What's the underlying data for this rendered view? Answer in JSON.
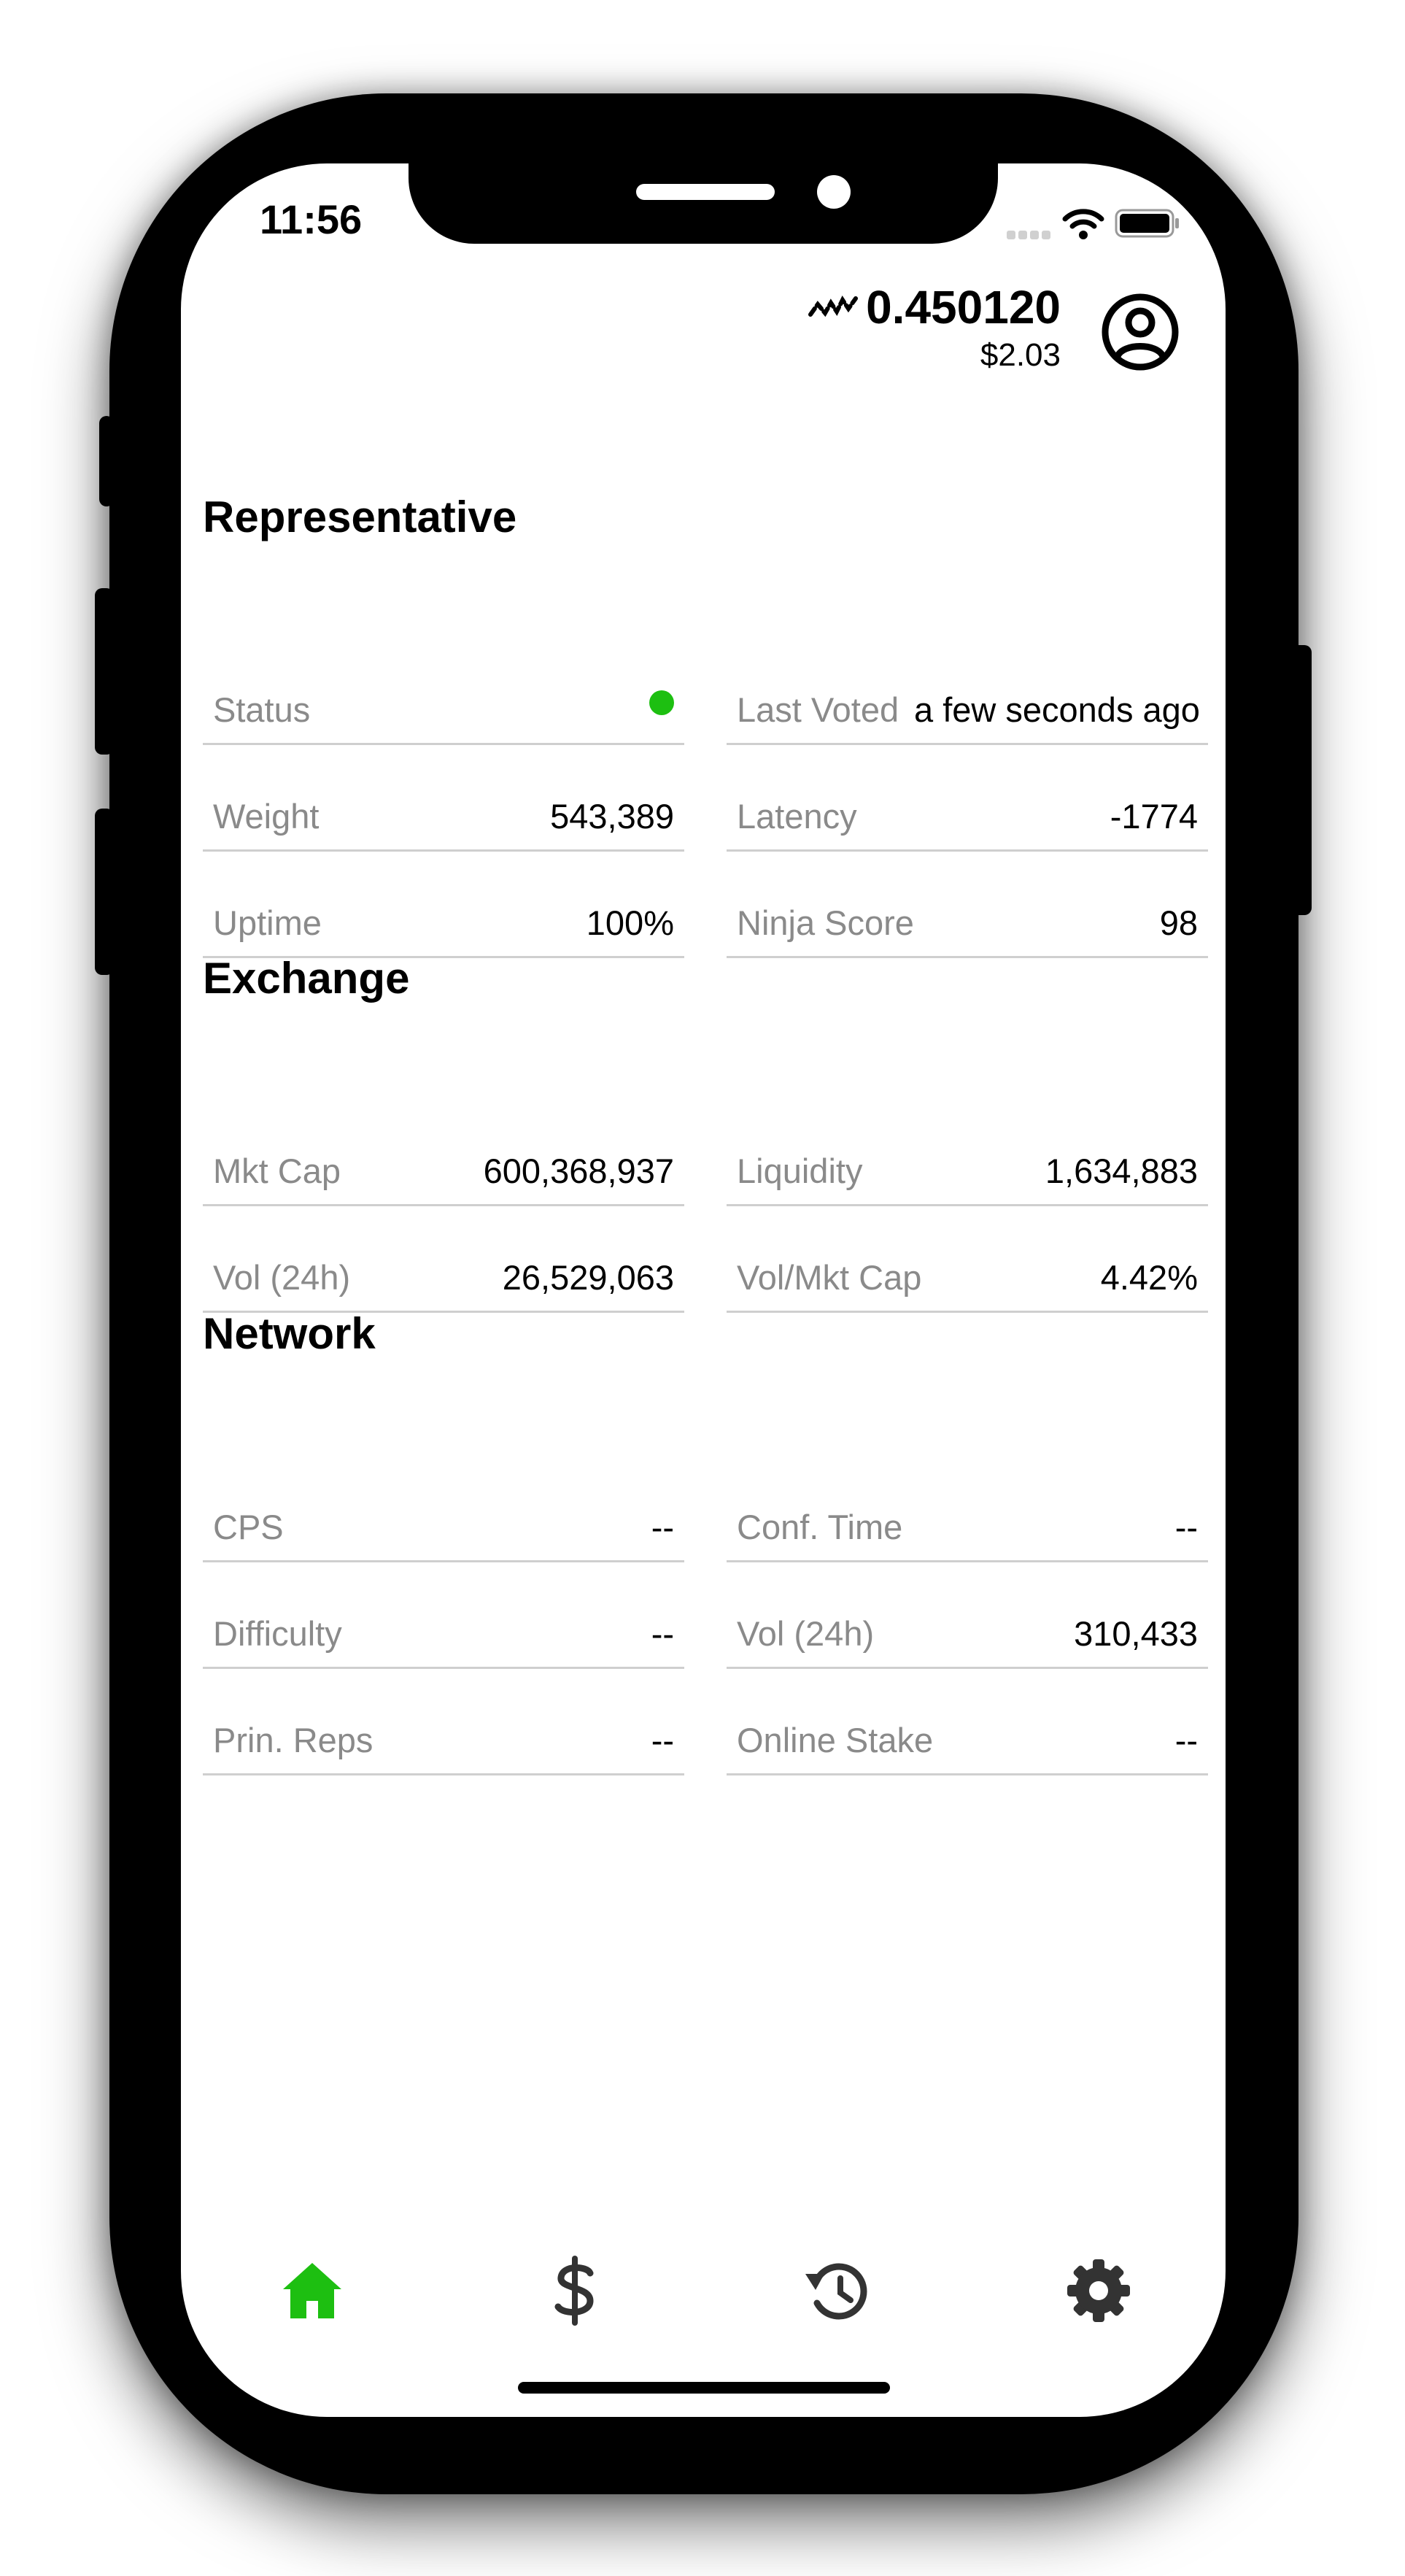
{
  "status_bar": {
    "time": "11:56"
  },
  "header": {
    "balance": "0.450120",
    "fiat": "$2.03"
  },
  "representative": {
    "title": "Representative",
    "status_label": "Status",
    "status_color": "#1dbf11",
    "last_voted_label": "Last Voted",
    "last_voted_value": "a few seconds ago",
    "weight_label": "Weight",
    "weight_value": "543,389",
    "latency_label": "Latency",
    "latency_value": "-1774",
    "uptime_label": "Uptime",
    "uptime_value": "100%",
    "ninja_label": "Ninja Score",
    "ninja_value": "98"
  },
  "exchange": {
    "title": "Exchange",
    "mktcap_label": "Mkt Cap",
    "mktcap_value": "600,368,937",
    "liquidity_label": "Liquidity",
    "liquidity_value": "1,634,883",
    "vol_label": "Vol (24h)",
    "vol_value": "26,529,063",
    "volmkt_label": "Vol/Mkt Cap",
    "volmkt_value": "4.42%"
  },
  "network": {
    "title": "Network",
    "cps_label": "CPS",
    "cps_value": "--",
    "conf_label": "Conf. Time",
    "conf_value": "--",
    "difficulty_label": "Difficulty",
    "difficulty_value": "--",
    "vol_label": "Vol (24h)",
    "vol_value": "310,433",
    "reps_label": "Prin. Reps",
    "reps_value": "--",
    "stake_label": "Online Stake",
    "stake_value": "--"
  },
  "tabbar": {
    "active_color": "#1dbf11",
    "inactive_color": "#333333",
    "items": [
      {
        "icon": "home-icon",
        "active": true
      },
      {
        "icon": "dollar-icon",
        "active": false
      },
      {
        "icon": "history-icon",
        "active": false
      },
      {
        "icon": "gear-icon",
        "active": false
      }
    ]
  }
}
